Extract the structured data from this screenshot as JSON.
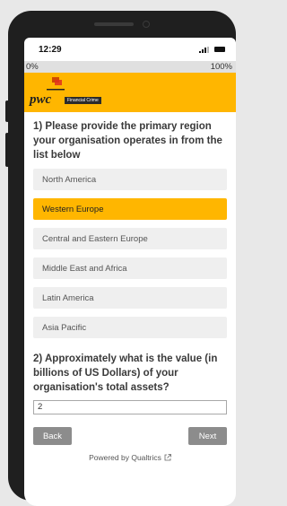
{
  "status_bar": {
    "time": "12:29"
  },
  "progress": {
    "start_label": "0%",
    "end_label": "100%",
    "value": 0
  },
  "banner": {
    "logo_word": "pwc",
    "logo_tag": "Financial Crime",
    "color": "#ffb600"
  },
  "question1": {
    "title": "1) Please provide the primary region your organisation operates in from the list below",
    "choices": [
      "North America",
      "Western Europe",
      "Central and Eastern Europe",
      "Middle East and Africa",
      "Latin America",
      "Asia Pacific"
    ],
    "selected": "Western Europe"
  },
  "question2": {
    "title": "2) Approximately what is the value (in billions of US Dollars) of your organisation's total assets?",
    "answer": "2"
  },
  "nav": {
    "back_label": "Back",
    "next_label": "Next"
  },
  "footer": {
    "powered_by": "Powered by Qualtrics",
    "icon": "external-link-icon"
  }
}
